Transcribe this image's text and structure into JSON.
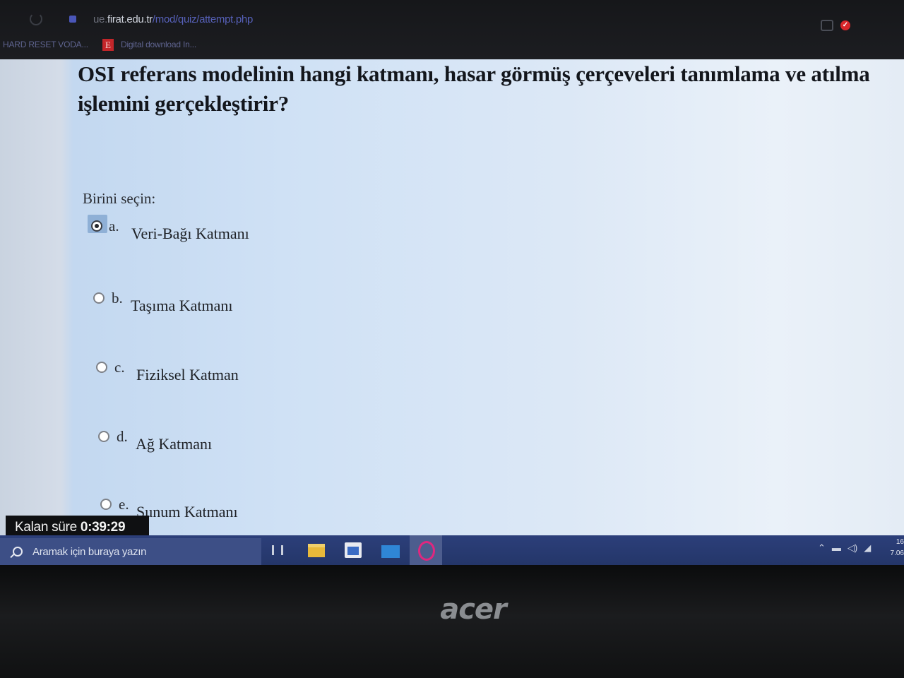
{
  "browser": {
    "url_prefix": "ue.",
    "url_host": "firat.edu.tr",
    "url_path": "/mod/quiz/attempt.php",
    "bookmarks": [
      {
        "label": "HARD RESET VODA..."
      },
      {
        "icon_letter": "E",
        "label": "Digital download In..."
      }
    ]
  },
  "quiz": {
    "question": "OSI referans modelinin hangi katmanı, hasar görmüş çerçeveleri tanımlama ve atılma işlemini gerçekleştirir?",
    "prompt": "Birini seçin:",
    "selected": "a",
    "options": [
      {
        "letter": "a.",
        "text": "Veri-Bağı Katmanı",
        "selected": true
      },
      {
        "letter": "b.",
        "text": "Taşıma Katmanı",
        "selected": false
      },
      {
        "letter": "c.",
        "text": "Fiziksel Katman",
        "selected": false
      },
      {
        "letter": "d.",
        "text": "Ağ Katmanı",
        "selected": false
      },
      {
        "letter": "e.",
        "text": "Sunum Katmanı",
        "selected": false
      }
    ],
    "timer_label": "Kalan süre",
    "timer_value": "0:39:29"
  },
  "taskbar": {
    "search_placeholder": "Aramak için buraya yazın",
    "clock_top": "16",
    "clock_bottom": "7.06"
  },
  "laptop": {
    "brand": "acer"
  }
}
